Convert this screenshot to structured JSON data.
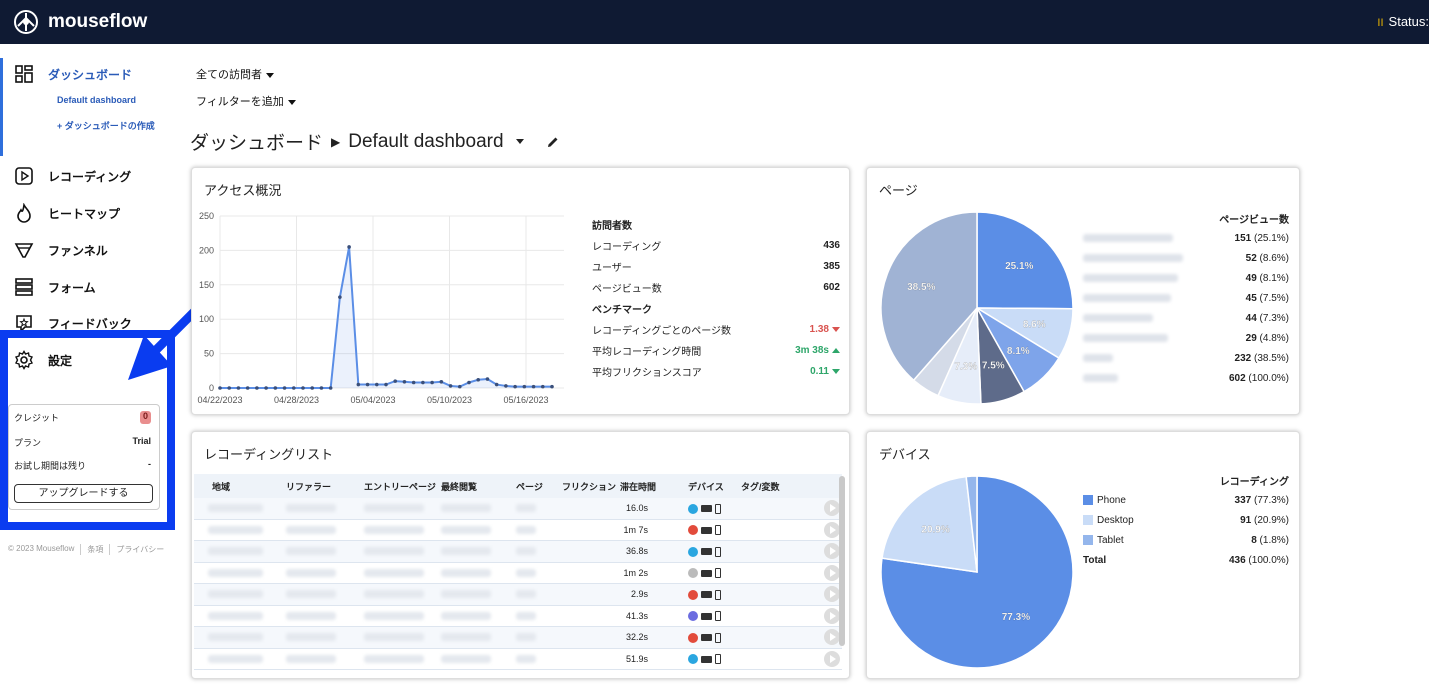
{
  "app": {
    "name": "mouseflow",
    "status": "Status:"
  },
  "sidebar": {
    "items": [
      {
        "label": "ダッシュボード",
        "icon": "dashboard-icon",
        "active": true
      },
      {
        "label": "レコーディング",
        "icon": "play-icon"
      },
      {
        "label": "ヒートマップ",
        "icon": "flame-icon"
      },
      {
        "label": "ファンネル",
        "icon": "funnel-icon"
      },
      {
        "label": "フォーム",
        "icon": "form-icon"
      },
      {
        "label": "フィードバック",
        "icon": "feedback-icon"
      },
      {
        "label": "設定",
        "icon": "gear-icon"
      }
    ],
    "sub": {
      "default": "Default dashboard",
      "create": "+ ダッシュボードの作成"
    },
    "credit": {
      "label": "クレジット",
      "value": "0",
      "plan_label": "プラン",
      "plan_value": "Trial",
      "trial_label": "お試し期間は残り",
      "trial_value": "-",
      "upgrade": "アップグレードする"
    },
    "footer": [
      "© 2023 Mouseflow",
      "条項",
      "プライバシー"
    ]
  },
  "filters": {
    "visitors": "全ての訪問者",
    "add": "フィルターを追加"
  },
  "breadcrumb": {
    "root": "ダッシュボード",
    "current": "Default dashboard"
  },
  "access": {
    "title": "アクセス概況",
    "stats_header": "訪問者数",
    "rows": [
      {
        "label": "レコーディング",
        "value": "436"
      },
      {
        "label": "ユーザー",
        "value": "385"
      },
      {
        "label": "ページビュー数",
        "value": "602"
      }
    ],
    "bench_header": "ベンチマーク",
    "bench": [
      {
        "label": "レコーディングごとのページ数",
        "value": "1.38",
        "trend": "down",
        "color": "#d9534f"
      },
      {
        "label": "平均レコーディング時間",
        "value": "3m 38s",
        "trend": "up",
        "color": "#2ea66a"
      },
      {
        "label": "平均フリクションスコア",
        "value": "0.11",
        "trend": "down",
        "color": "#2ea66a"
      }
    ]
  },
  "chart_data": [
    {
      "type": "line",
      "title": "",
      "ylim": [
        0,
        250
      ],
      "yticks": [
        "250",
        "200",
        "150",
        "100",
        "50",
        "0"
      ],
      "xticks": [
        "04/22/2023",
        "04/28/2023",
        "05/04/2023",
        "05/10/2023",
        "05/16/2023"
      ],
      "values": [
        0,
        0,
        0,
        0,
        0,
        0,
        0,
        0,
        0,
        0,
        0,
        0,
        0,
        132,
        205,
        5,
        5,
        5,
        5,
        10,
        9,
        8,
        8,
        8,
        9,
        3,
        2,
        8,
        12,
        13,
        5,
        3,
        2,
        2,
        2,
        2,
        2
      ],
      "color": "#5b8ee6"
    },
    {
      "type": "pie",
      "title": "ページ",
      "values": [
        25.1,
        8.6,
        8.1,
        7.5,
        7.3,
        4.8,
        38.5
      ],
      "labels": [
        "25.1%",
        "8.6%",
        "8.1%",
        "7.5%",
        "7.3%",
        "",
        "38.5%"
      ],
      "colors": [
        "#5b8ee6",
        "#c9dcf7",
        "#7ea4ea",
        "#5e6b8a",
        "#e6edf9",
        "#d4dbe8",
        "#a0b3d4"
      ]
    },
    {
      "type": "pie",
      "title": "デバイス",
      "values": [
        77.3,
        20.9,
        1.8
      ],
      "labels": [
        "77.3%",
        "20.9%",
        ""
      ],
      "colors": [
        "#5b8ee6",
        "#c9dcf7",
        "#94b6ec"
      ]
    }
  ],
  "pages": {
    "header": "ページビュー数",
    "rows": [
      {
        "count": "151",
        "pct": "(25.1%)"
      },
      {
        "count": "52",
        "pct": "(8.6%)"
      },
      {
        "count": "49",
        "pct": "(8.1%)"
      },
      {
        "count": "45",
        "pct": "(7.5%)"
      },
      {
        "count": "44",
        "pct": "(7.3%)"
      },
      {
        "count": "29",
        "pct": "(4.8%)"
      },
      {
        "count": "232",
        "pct": "(38.5%)"
      },
      {
        "count": "602",
        "pct": "(100.0%)"
      }
    ]
  },
  "devices": {
    "header": "レコーディング",
    "rows": [
      {
        "label": "Phone",
        "count": "337",
        "pct": "(77.3%)",
        "color": "#5b8ee6"
      },
      {
        "label": "Desktop",
        "count": "91",
        "pct": "(20.9%)",
        "color": "#c9dcf7"
      },
      {
        "label": "Tablet",
        "count": "8",
        "pct": "(1.8%)",
        "color": "#94b6ec"
      }
    ],
    "total": {
      "label": "Total",
      "count": "436",
      "pct": "(100.0%)"
    }
  },
  "recordings": {
    "title": "レコーディングリスト",
    "headers": [
      "地域",
      "リファラー",
      "エントリーページ",
      "最終閲覧",
      "ページ",
      "フリクション",
      "滞在時間",
      "デバイス",
      "タグ/変数"
    ],
    "rows": [
      {
        "time": "16.0s",
        "browser": "safari"
      },
      {
        "time": "1m 7s",
        "browser": "chrome"
      },
      {
        "time": "36.8s",
        "browser": "safari"
      },
      {
        "time": "1m 2s",
        "browser": "unknown"
      },
      {
        "time": "2.9s",
        "browser": "chrome"
      },
      {
        "time": "41.3s",
        "browser": "other"
      },
      {
        "time": "32.2s",
        "browser": "chrome"
      },
      {
        "time": "51.9s",
        "browser": "safari"
      }
    ]
  }
}
